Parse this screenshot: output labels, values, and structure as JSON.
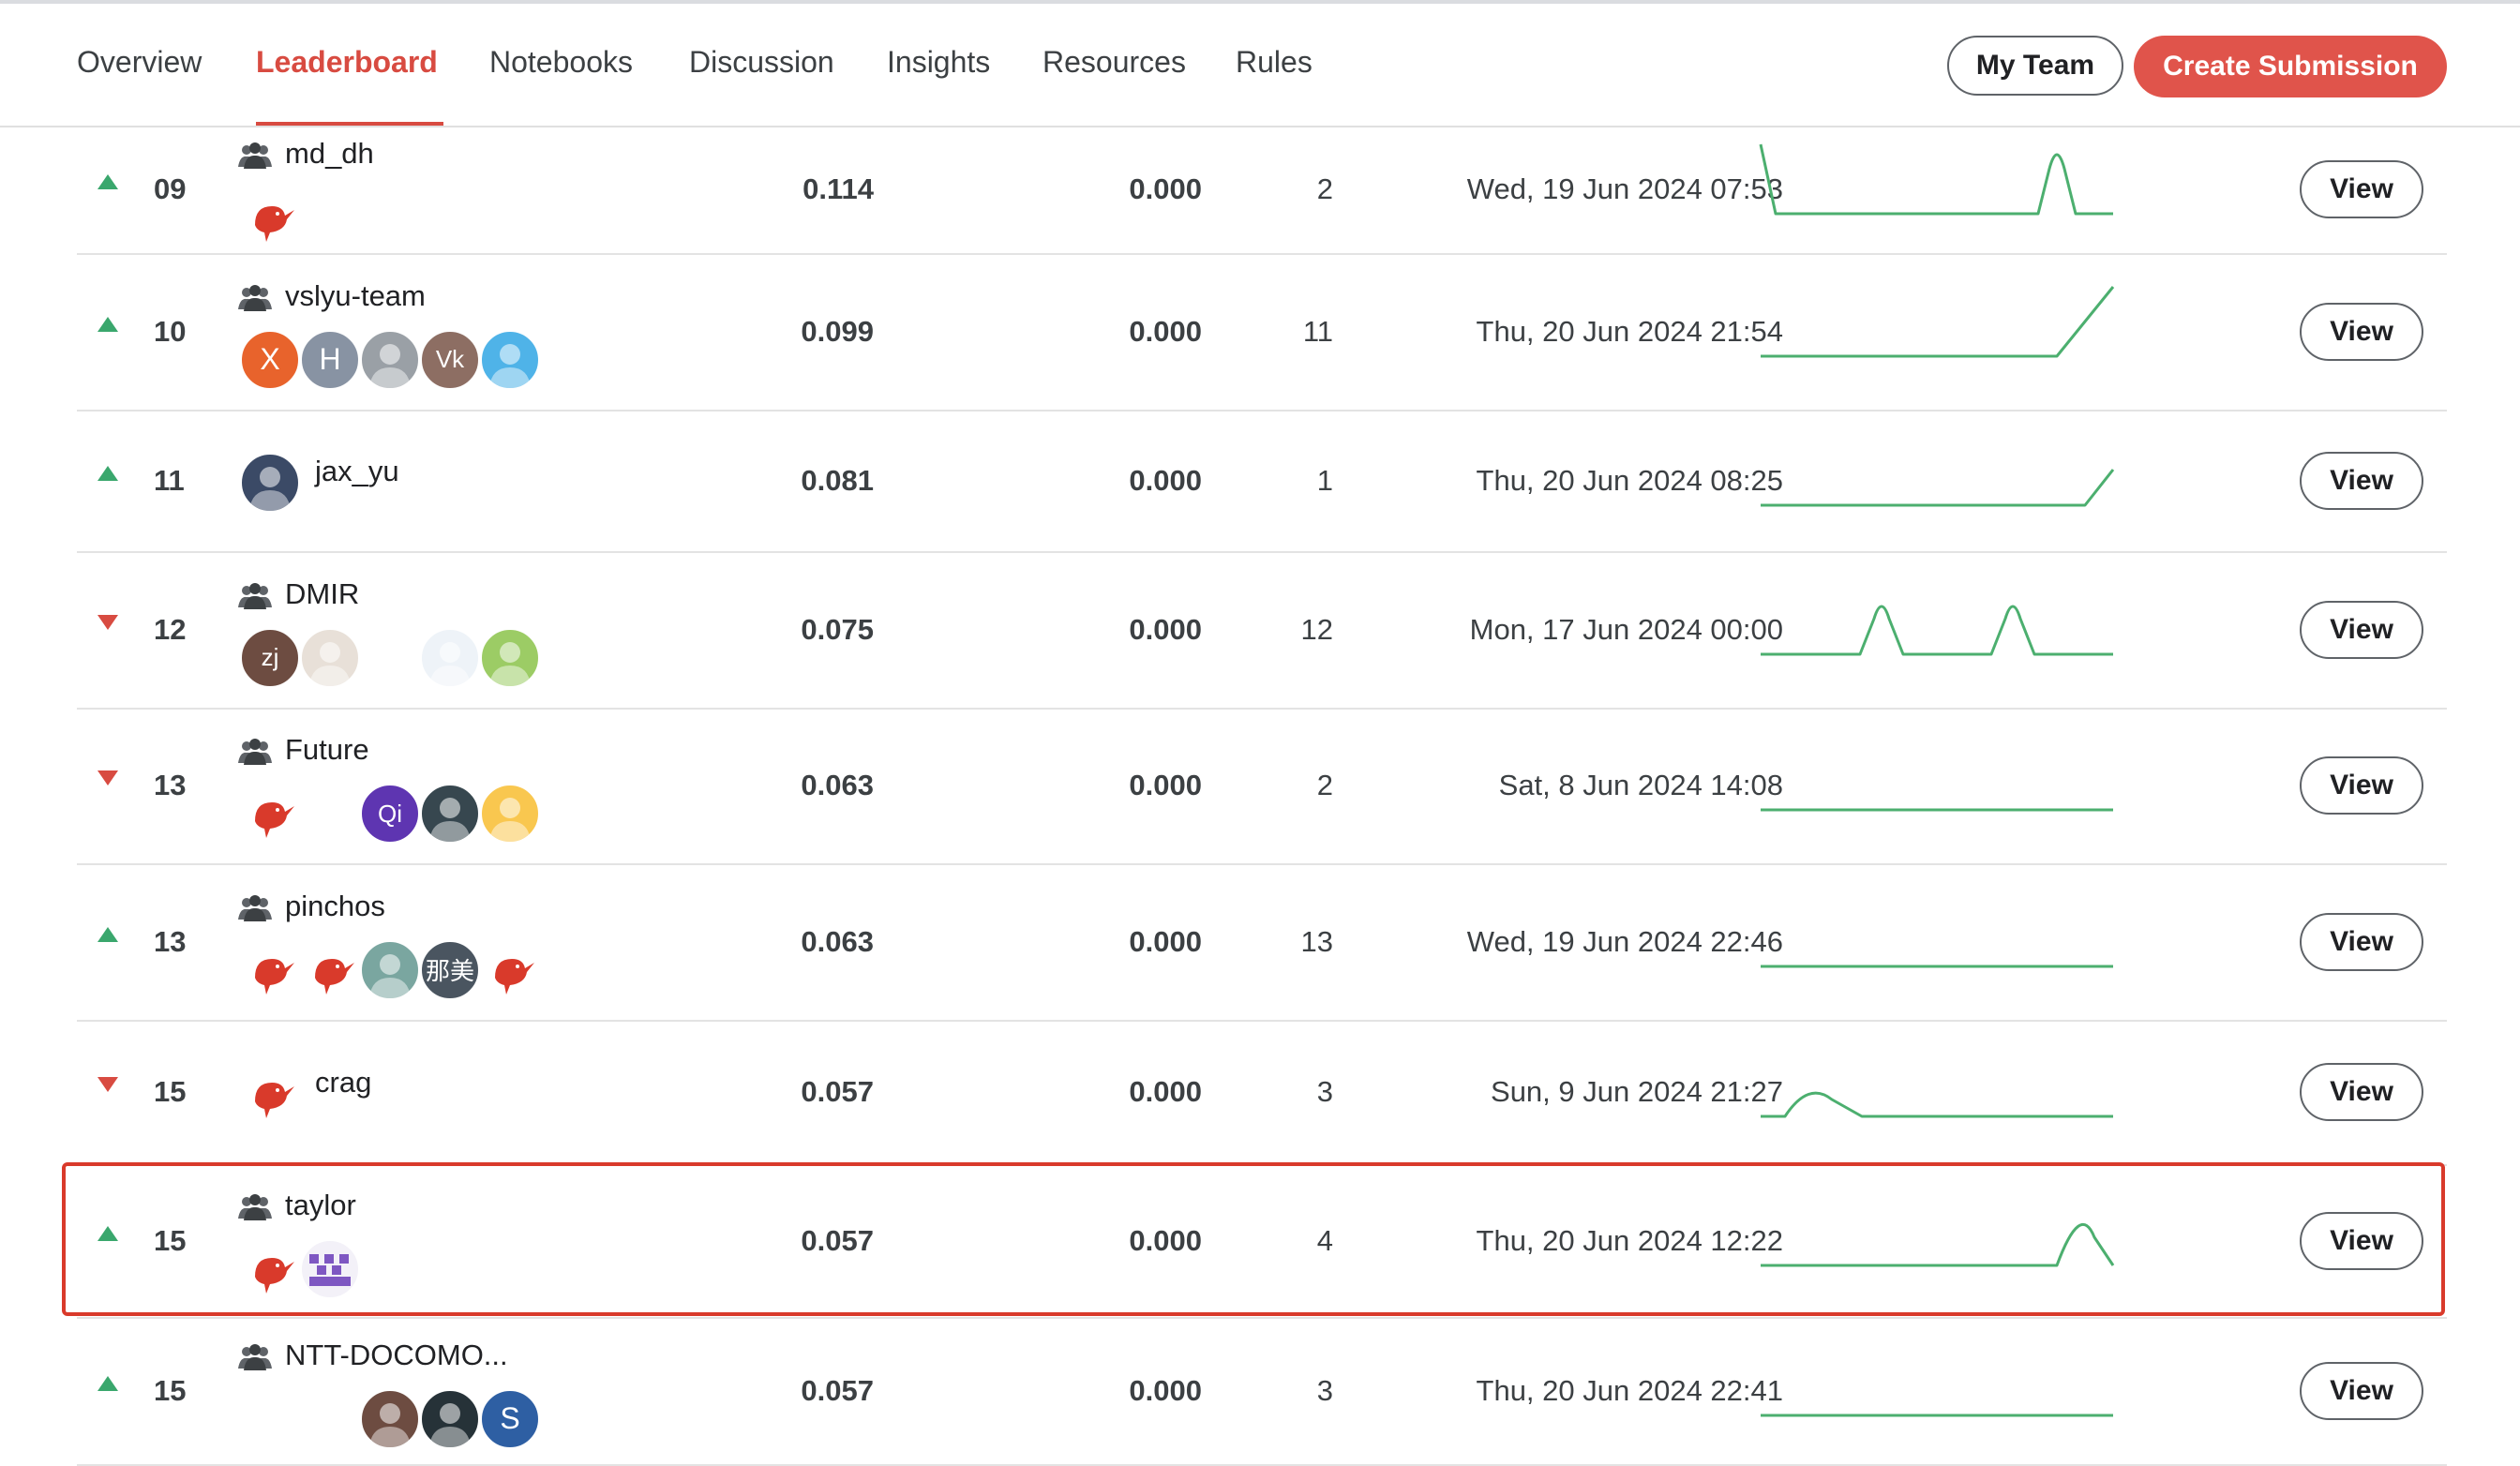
{
  "nav": {
    "tabs": [
      "Overview",
      "Leaderboard",
      "Notebooks",
      "Discussion",
      "Insights",
      "Resources",
      "Rules"
    ],
    "active_tab": "Leaderboard",
    "my_team": "My Team",
    "create_submission": "Create Submission"
  },
  "colors": {
    "accent": "#d84b41",
    "up": "#3aa76d",
    "down": "#d84b41",
    "spark": "#4caf6f"
  },
  "rows": [
    {
      "trend": "up",
      "rank": "09",
      "team": "md_dh",
      "is_team": true,
      "score": "0.114",
      "score2": "0.000",
      "entries": "2",
      "last": "Wed, 19 Jun 2024 07:53",
      "avatars": [
        {
          "icon": "kiwi-bird-icon",
          "bg": "#ffffff"
        }
      ]
    },
    {
      "trend": "up",
      "rank": "10",
      "team": "vslyu-team",
      "is_team": true,
      "score": "0.099",
      "score2": "0.000",
      "entries": "11",
      "last": "Thu, 20 Jun 2024 21:54",
      "avatars": [
        {
          "initial": "X",
          "bg": "#e8632c"
        },
        {
          "initial": "H",
          "bg": "#8893a3"
        },
        {
          "icon": "photo-avatar-icon",
          "bg": "#9aa0a6"
        },
        {
          "initial": "Vk",
          "bg": "#8d6e63"
        },
        {
          "icon": "cat-avatar-icon",
          "bg": "#4fb3e8"
        }
      ]
    },
    {
      "trend": "up",
      "rank": "11",
      "team": "jax_yu",
      "is_team": false,
      "score": "0.081",
      "score2": "0.000",
      "entries": "1",
      "last": "Thu, 20 Jun 2024 08:25",
      "avatars": [
        {
          "icon": "photo-avatar-icon",
          "bg": "#3b4a66"
        }
      ]
    },
    {
      "trend": "down",
      "rank": "12",
      "team": "DMIR",
      "is_team": true,
      "score": "0.075",
      "score2": "0.000",
      "entries": "12",
      "last": "Mon, 17 Jun 2024 00:00",
      "avatars": [
        {
          "initial": "zj",
          "bg": "#6d4c41"
        },
        {
          "icon": "person-avatar-icon",
          "bg": "#e8e0d8"
        },
        {
          "icon": "dmir-logo-icon",
          "bg": "#ffffff"
        },
        {
          "icon": "network-avatar-icon",
          "bg": "#eef3f8"
        },
        {
          "icon": "h-avatar-icon",
          "bg": "#9ccc65"
        }
      ]
    },
    {
      "trend": "down",
      "rank": "13",
      "team": "Future",
      "is_team": true,
      "score": "0.063",
      "score2": "0.000",
      "entries": "2",
      "last": "Sat, 8 Jun 2024 14:08",
      "avatars": [
        {
          "icon": "kiwi-bird-icon",
          "bg": "#ffffff"
        },
        {
          "icon": "microscope-avatar-icon",
          "bg": "#ffffff"
        },
        {
          "initial": "Qi",
          "bg": "#5e35b1"
        },
        {
          "icon": "photo-avatar-icon",
          "bg": "#37474f"
        },
        {
          "icon": "girl-avatar-icon",
          "bg": "#f9c74f"
        }
      ]
    },
    {
      "trend": "up",
      "rank": "13",
      "team": "pinchos",
      "is_team": true,
      "score": "0.063",
      "score2": "0.000",
      "entries": "13",
      "last": "Wed, 19 Jun 2024 22:46",
      "avatars": [
        {
          "icon": "kiwi-bird-icon",
          "bg": "#ffffff"
        },
        {
          "icon": "kiwi-bird-icon",
          "bg": "#ffffff"
        },
        {
          "icon": "cartoon-avatar-icon",
          "bg": "#7aa6a0"
        },
        {
          "initial": "那美",
          "bg": "#4a5560"
        },
        {
          "icon": "kiwi-bird-icon",
          "bg": "#ffffff"
        }
      ]
    },
    {
      "trend": "down",
      "rank": "15",
      "team": "crag",
      "is_team": false,
      "score": "0.057",
      "score2": "0.000",
      "entries": "3",
      "last": "Sun, 9 Jun 2024 21:27",
      "avatars": [
        {
          "icon": "kiwi-bird-icon",
          "bg": "#ffffff"
        }
      ]
    },
    {
      "trend": "up",
      "rank": "15",
      "team": "taylor",
      "is_team": true,
      "score": "0.057",
      "score2": "0.000",
      "entries": "4",
      "last": "Thu, 20 Jun 2024 12:22",
      "avatars": [
        {
          "icon": "kiwi-bird-icon",
          "bg": "#ffffff"
        },
        {
          "icon": "pixel-avatar-icon",
          "bg": "#f3f1f8"
        }
      ]
    },
    {
      "trend": "up",
      "rank": "15",
      "team": "NTT-DOCOMO...",
      "is_team": true,
      "score": "0.057",
      "score2": "0.000",
      "entries": "3",
      "last": "Thu, 20 Jun 2024 22:41",
      "avatars": [
        {
          "icon": "toy-avatar-icon",
          "bg": "#ffffff"
        },
        {
          "icon": "sketch-avatar-icon",
          "bg": "#ffffff"
        },
        {
          "icon": "monkey-avatar-icon",
          "bg": "#6d4c41"
        },
        {
          "icon": "photo-avatar-icon",
          "bg": "#263238"
        },
        {
          "initial": "S",
          "bg": "#2e5fa3"
        }
      ]
    }
  ],
  "view_label": "View"
}
